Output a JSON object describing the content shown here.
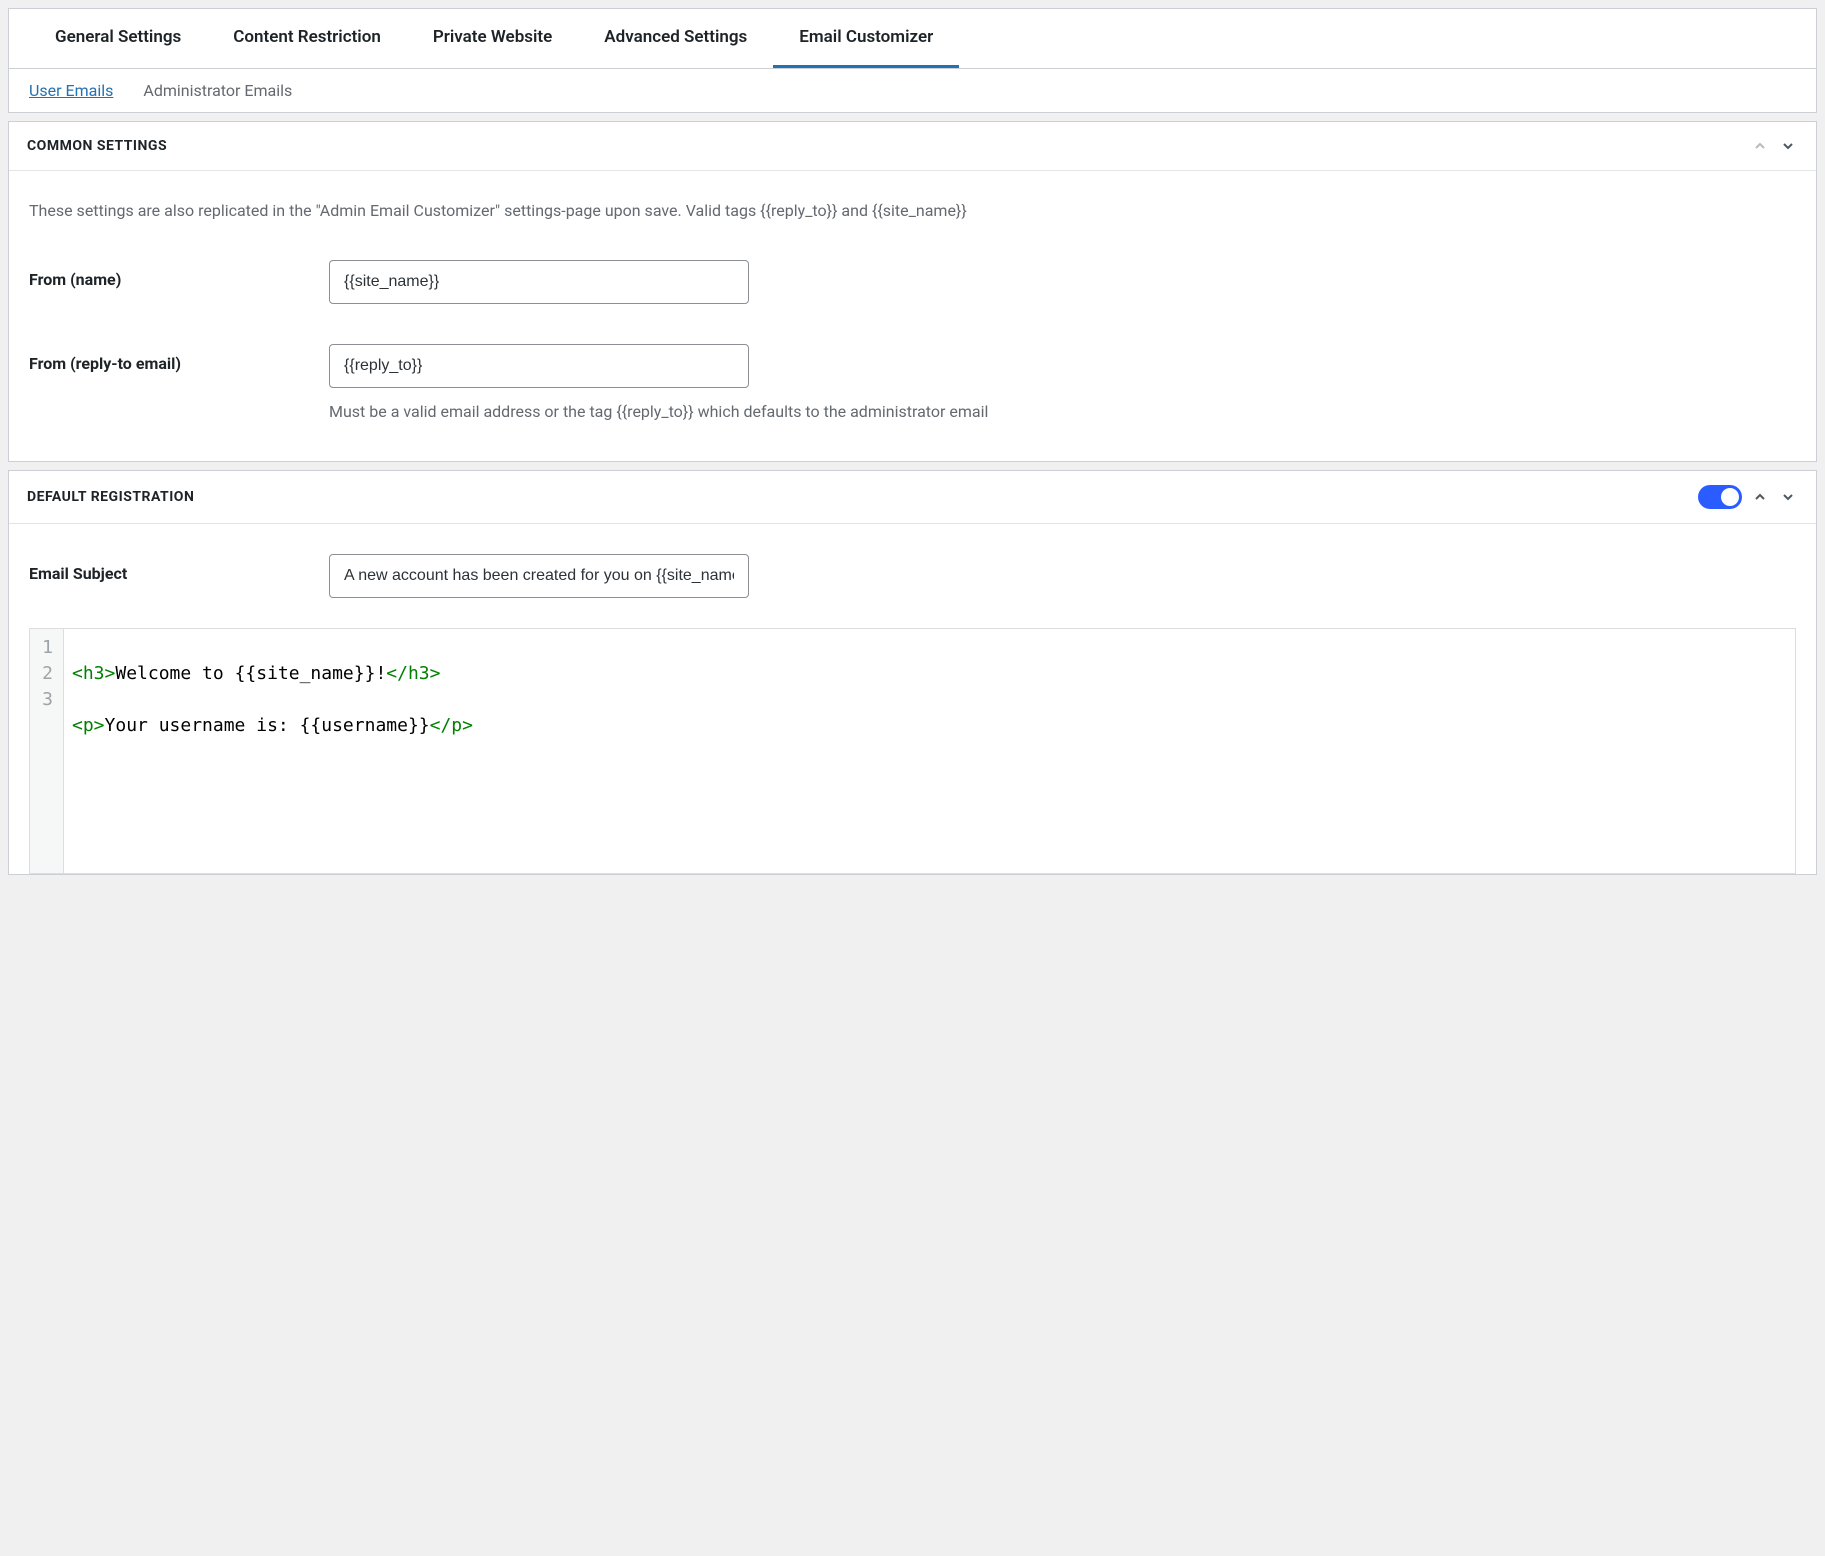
{
  "tabs": {
    "primary": [
      {
        "label": "General Settings",
        "active": false
      },
      {
        "label": "Content Restriction",
        "active": false
      },
      {
        "label": "Private Website",
        "active": false
      },
      {
        "label": "Advanced Settings",
        "active": false
      },
      {
        "label": "Email Customizer",
        "active": true
      }
    ],
    "secondary": [
      {
        "label": "User Emails",
        "active": true
      },
      {
        "label": "Administrator Emails",
        "active": false
      }
    ]
  },
  "common": {
    "title": "COMMON SETTINGS",
    "description": "These settings are also replicated in the \"Admin Email Customizer\" settings-page upon save. Valid tags {{reply_to}} and {{site_name}}",
    "from_name_label": "From (name)",
    "from_name_value": "{{site_name}}",
    "from_reply_label": "From (reply-to email)",
    "from_reply_value": "{{reply_to}}",
    "from_reply_desc": "Must be a valid email address or the tag {{reply_to}} which defaults to the administrator email"
  },
  "default_registration": {
    "title": "DEFAULT REGISTRATION",
    "enabled": true,
    "subject_label": "Email Subject",
    "subject_value": "A new account has been created for you on {{site_name}}",
    "code_lines": [
      {
        "tag_open": "<h3>",
        "text": "Welcome to {{site_name}}!",
        "tag_close": "</h3>"
      },
      {
        "tag_open": "<p>",
        "text": "Your username is: {{username}}",
        "tag_close": "</p>"
      }
    ],
    "gutter_lines": [
      "1",
      "2",
      "3"
    ]
  }
}
